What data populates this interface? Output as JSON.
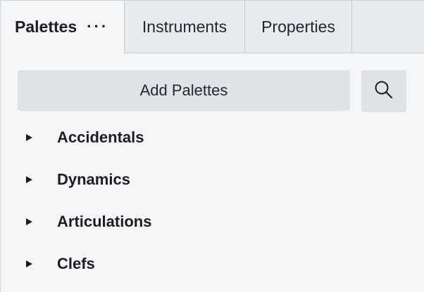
{
  "tabs": [
    {
      "label": "Palettes",
      "active": true
    },
    {
      "label": "Instruments",
      "active": false
    },
    {
      "label": "Properties",
      "active": false
    }
  ],
  "tab_menu_label": "···",
  "toolbar": {
    "add_palettes_label": "Add Palettes",
    "search_icon": "search-icon"
  },
  "palettes": [
    {
      "label": "Accidentals",
      "icon": "expand-arrow-icon"
    },
    {
      "label": "Dynamics",
      "icon": "expand-arrow-icon"
    },
    {
      "label": "Articulations",
      "icon": "expand-arrow-icon"
    },
    {
      "label": "Clefs",
      "icon": "expand-arrow-icon"
    }
  ],
  "colors": {
    "background": "#f5f6f8",
    "tab_inactive": "#e7eaee",
    "button": "#dfe2e6",
    "text": "#1b1d22"
  }
}
